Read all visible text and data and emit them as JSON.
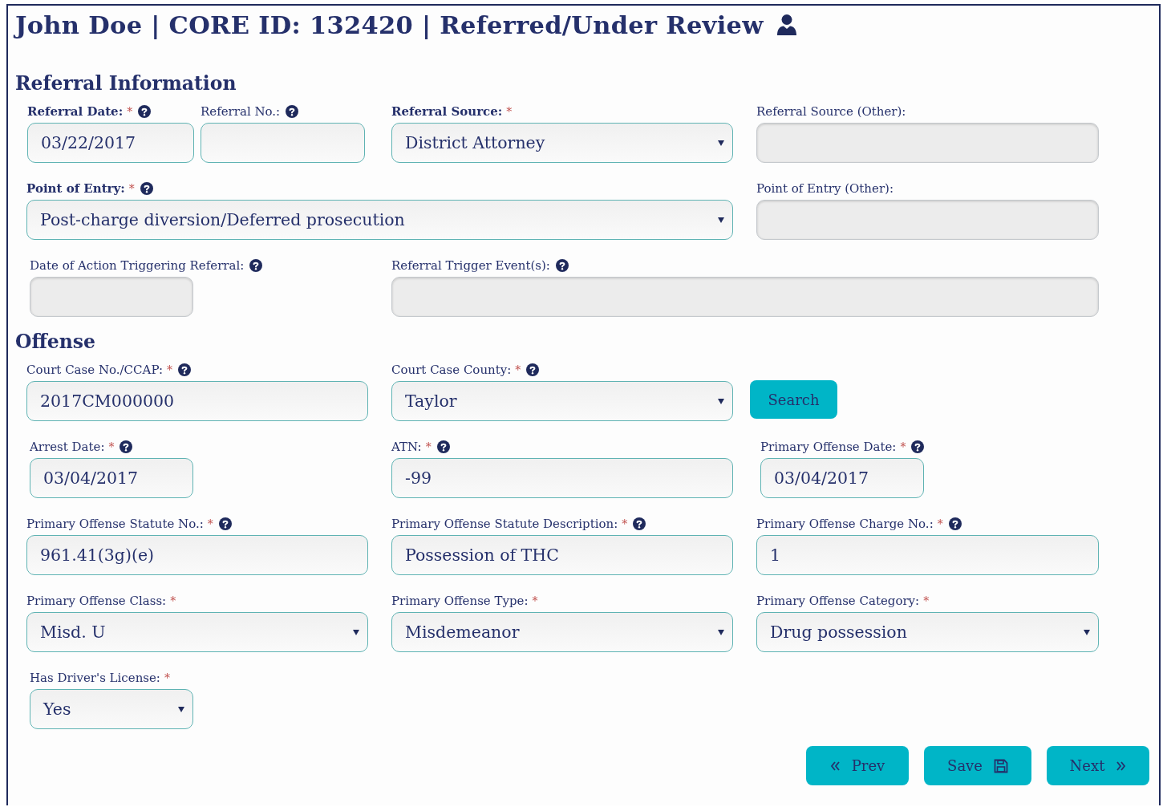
{
  "header": {
    "title": "John Doe | CORE ID: 132420 | Referred/Under Review"
  },
  "sections": [
    {
      "heading": "Referral Information",
      "rows": [
        {
          "fields": [
            {
              "kind": "text",
              "label": "Referral Date:",
              "bold": true,
              "required_mark": "*",
              "help": true,
              "disabled": false,
              "value": "03/22/2017"
            },
            {
              "kind": "text",
              "label": "Referral No.:",
              "bold": false,
              "help": true,
              "disabled": false
            },
            {
              "kind": "select",
              "label": "Referral Source:",
              "bold": true,
              "required_mark": "*",
              "help": false,
              "disabled": false,
              "value": "District Attorney"
            },
            {
              "kind": "text",
              "label": "Referral Source (Other):",
              "bold": false,
              "help": false,
              "disabled": true
            }
          ]
        },
        {
          "fields": [
            {
              "kind": "select",
              "label": "Point of Entry:",
              "bold": true,
              "required_mark": "*",
              "help": true,
              "disabled": false,
              "value": "Post-charge diversion/Deferred prosecution"
            },
            {
              "kind": "text",
              "label": "Point of Entry (Other):",
              "bold": false,
              "help": false,
              "disabled": true
            }
          ]
        },
        {
          "fields": [
            {
              "kind": "text",
              "label": "Date of Action Triggering Referral:",
              "bold": false,
              "help": true,
              "disabled": true
            },
            {
              "kind": "text",
              "label": "Referral Trigger Event(s):",
              "bold": false,
              "help": true,
              "disabled": true
            }
          ]
        }
      ]
    },
    {
      "heading": "Offense",
      "rows": [
        {
          "fields": [
            {
              "kind": "text",
              "label": "Court Case No./CCAP:",
              "bold": false,
              "required_mark": "*",
              "help": true,
              "disabled": false,
              "value": "2017CM000000"
            },
            {
              "kind": "select",
              "label": "Court Case County:",
              "bold": false,
              "required_mark": "*",
              "help": true,
              "disabled": false,
              "value": "Taylor"
            },
            {
              "kind": "button",
              "label": "Search"
            }
          ]
        },
        {
          "fields": [
            {
              "kind": "text",
              "label": "Arrest Date:",
              "bold": false,
              "required_mark": "*",
              "help": true,
              "disabled": false,
              "value": "03/04/2017"
            },
            {
              "kind": "text",
              "label": "ATN:",
              "bold": false,
              "required_mark": "*",
              "help": true,
              "disabled": false,
              "value": "-99"
            },
            {
              "kind": "text",
              "label": "Primary Offense Date:",
              "bold": false,
              "required_mark": "*",
              "help": true,
              "disabled": false,
              "value": "03/04/2017"
            }
          ]
        },
        {
          "fields": [
            {
              "kind": "text",
              "label": "Primary Offense Statute No.:",
              "bold": false,
              "required_mark": "*",
              "help": true,
              "disabled": false,
              "value": "961.41(3g)(e)"
            },
            {
              "kind": "text",
              "label": "Primary Offense Statute Description:",
              "bold": false,
              "required_mark": "*",
              "help": true,
              "disabled": false,
              "value": "Possession of THC"
            },
            {
              "kind": "text",
              "label": "Primary Offense Charge No.:",
              "bold": false,
              "required_mark": "*",
              "help": true,
              "disabled": false,
              "value": "1"
            }
          ]
        },
        {
          "fields": [
            {
              "kind": "select",
              "label": "Primary Offense Class:",
              "bold": false,
              "required_mark": "*",
              "help": false,
              "disabled": false,
              "value": "Misd. U"
            },
            {
              "kind": "select",
              "label": "Primary Offense Type:",
              "bold": false,
              "required_mark": "*",
              "help": false,
              "disabled": false,
              "value": "Misdemeanor"
            },
            {
              "kind": "select",
              "label": "Primary Offense Category:",
              "bold": false,
              "required_mark": "*",
              "help": false,
              "disabled": false,
              "value": "Drug possession"
            }
          ]
        },
        {
          "fields": [
            {
              "kind": "select",
              "label": "Has Driver's License:",
              "bold": false,
              "required_mark": "*",
              "help": false,
              "disabled": false,
              "value": "Yes"
            }
          ]
        }
      ]
    }
  ],
  "nav_buttons": [
    {
      "kind": "prev",
      "label": "Prev"
    },
    {
      "kind": "save",
      "label": "Save"
    },
    {
      "kind": "next",
      "label": "Next"
    }
  ]
}
